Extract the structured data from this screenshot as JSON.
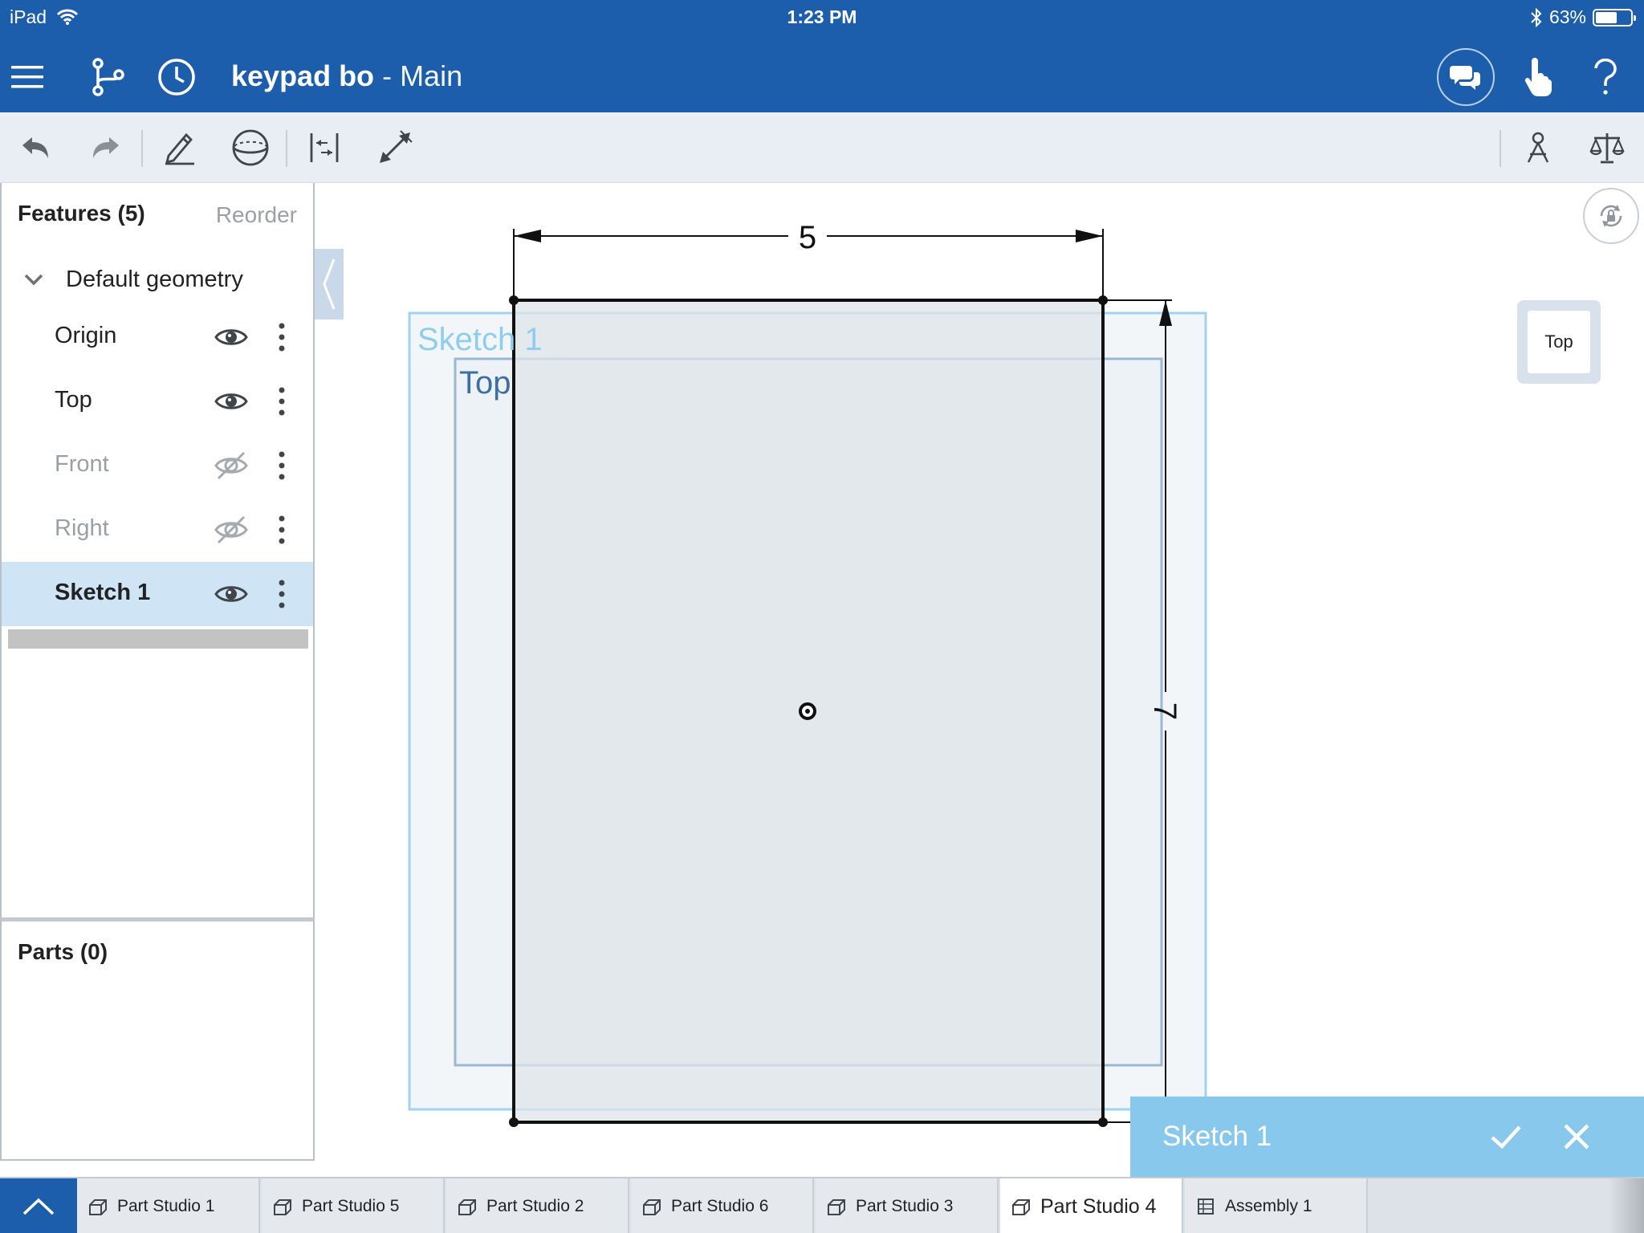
{
  "status_bar": {
    "device": "iPad",
    "time": "1:23 PM",
    "battery": "63%",
    "battery_level": 0.63
  },
  "header": {
    "doc_name": "keypad bo",
    "separator": " - ",
    "branch": "Main",
    "icons": [
      "menu-icon",
      "branch-icon",
      "history-icon",
      "comments-icon",
      "touch-mode-icon",
      "help-icon"
    ]
  },
  "toolbar": {
    "icons": [
      "undo-icon",
      "redo-icon",
      "sketch-pencil-icon",
      "plane-icon",
      "distance-icon",
      "measure-arrow-icon",
      "mate-connector-icon",
      "mass-properties-icon"
    ]
  },
  "features": {
    "title": "Features (5)",
    "reorder_label": "Reorder",
    "group_label": "Default geometry",
    "items": [
      {
        "label": "Origin",
        "visible": true,
        "selected": false
      },
      {
        "label": "Top",
        "visible": true,
        "selected": false
      },
      {
        "label": "Front",
        "visible": false,
        "selected": false
      },
      {
        "label": "Right",
        "visible": false,
        "selected": false
      },
      {
        "label": "Sketch 1",
        "visible": true,
        "selected": true
      }
    ]
  },
  "parts": {
    "title": "Parts (0)"
  },
  "canvas": {
    "sketch_plane_label": "Sketch 1",
    "top_plane_label": "Top",
    "dim_width": "5",
    "dim_height": "7",
    "view_cube_face": "Top"
  },
  "sketch_dialog": {
    "title": "Sketch 1"
  },
  "tabs": [
    {
      "label": "Part Studio 1",
      "type": "part",
      "active": false
    },
    {
      "label": "Part Studio 5",
      "type": "part",
      "active": false
    },
    {
      "label": "Part Studio 2",
      "type": "part",
      "active": false
    },
    {
      "label": "Part Studio 6",
      "type": "part",
      "active": false
    },
    {
      "label": "Part Studio 3",
      "type": "part",
      "active": false
    },
    {
      "label": "Part Studio 4",
      "type": "part",
      "active": true
    },
    {
      "label": "Assembly 1",
      "type": "assembly",
      "active": false
    }
  ],
  "colors": {
    "header_blue": "#1c5eab",
    "selection_blue": "#cfe5f6",
    "dialog_blue": "#88c8ec",
    "plane_blue": "#9fd3ee"
  }
}
